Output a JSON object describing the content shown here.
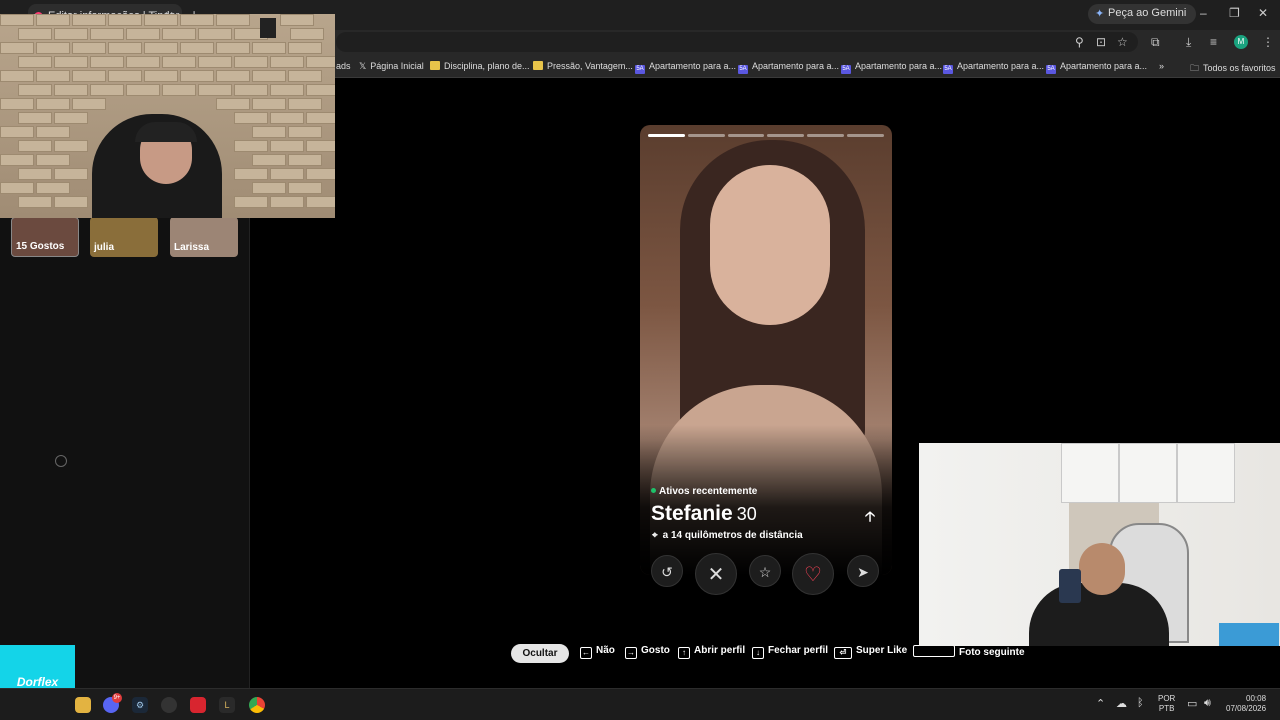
{
  "browser": {
    "tab_title": "Editar informações | Tinder",
    "gemini_label": "Peça ao Gemini",
    "avatar_letter": "M",
    "bookmarks": [
      {
        "label": "ads",
        "icon": "none"
      },
      {
        "label": "Página Inicial",
        "icon": "x-icon"
      },
      {
        "label": "Disciplina, plano de...",
        "icon": "folder"
      },
      {
        "label": "Pressão, Vantagem...",
        "icon": "folder"
      },
      {
        "label": "Apartamento para a...",
        "icon": "sa"
      },
      {
        "label": "Apartamento para a...",
        "icon": "sa"
      },
      {
        "label": "Apartamento para a...",
        "icon": "sa"
      },
      {
        "label": "Apartamento para a...",
        "icon": "sa"
      },
      {
        "label": "Apartamento para a...",
        "icon": "sa"
      }
    ],
    "all_favorites": "Todos os favoritos"
  },
  "sidebar": {
    "matches": [
      {
        "label": "15 Gostos",
        "color": "#6b4a3f"
      },
      {
        "label": "julia",
        "color": "#8a6e3a"
      },
      {
        "label": "Larissa",
        "color": "#9c8575"
      }
    ]
  },
  "card": {
    "photo_count": 6,
    "photo_index": 1,
    "status": "Ativos recentemente",
    "status_color": "#1ec26a",
    "name": "Stefanie",
    "age": "30",
    "distance": "a 14 quilômetros de distância"
  },
  "actions": [
    {
      "name": "rewind",
      "glyph": "↺"
    },
    {
      "name": "nope",
      "glyph": "✕"
    },
    {
      "name": "super-like",
      "glyph": "☆"
    },
    {
      "name": "like",
      "glyph": "♡"
    },
    {
      "name": "boost",
      "glyph": "➤"
    }
  ],
  "shortcuts": {
    "hide": "Ocultar",
    "no": "Não",
    "like": "Gosto",
    "open_profile": "Abrir perfil",
    "close_profile": "Fechar perfil",
    "super_like": "Super Like",
    "next_photo": "Foto seguinte"
  },
  "ad": {
    "brand": "Dorflex",
    "color": "#14d4e8"
  },
  "taskbar": {
    "lang_top": "POR",
    "lang_bottom": "PTB",
    "time": "00:08",
    "date": "07/08/2026",
    "discord_badge": "9+"
  }
}
